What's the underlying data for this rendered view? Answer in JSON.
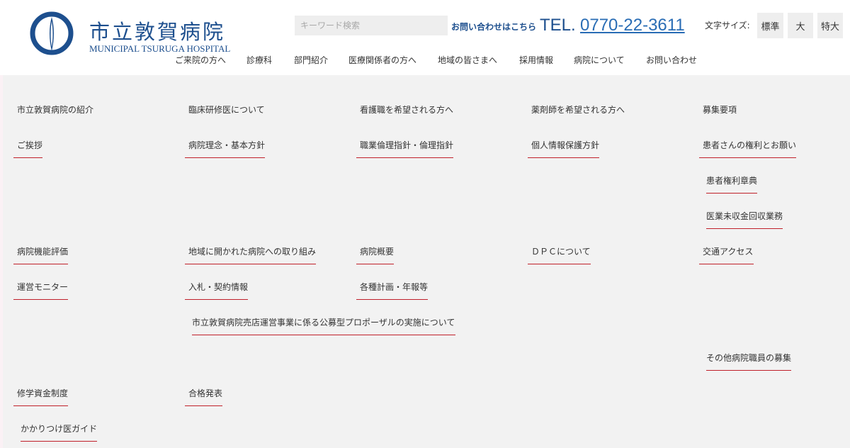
{
  "header": {
    "logo_ja": "市立敦賀病院",
    "logo_en": "MUNICIPAL TSURUGA HOSPITAL",
    "search_placeholder": "キーワード検索",
    "contact_label": "お問い合わせはこちら",
    "tel_prefix": "TEL.",
    "tel_number": "0770-22-3611",
    "font_size_label": "文字サイズ:",
    "font_sizes": [
      "標準",
      "大",
      "特大"
    ]
  },
  "global_nav": [
    "ご来院の方へ",
    "診療科",
    "部門紹介",
    "医療関係者の方へ",
    "地域の皆さまへ",
    "採用情報",
    "病院について",
    "お問い合わせ"
  ],
  "mega_menu": {
    "col_headings": [
      "市立敦賀病院の紹介",
      "臨床研修医について",
      "看護職を希望される方へ",
      "薬剤師を希望される方へ",
      "募集要項"
    ],
    "items": [
      "ご挨拶",
      "病院理念・基本方針",
      "職業倫理指針・倫理指針",
      "個人情報保護方針",
      "患者さんの権利とお願い",
      "患者権利章典",
      "医業未収金回収業務",
      "病院機能評価",
      "地域に開かれた病院への取り組み",
      "病院概要",
      "ＤＰＣについて",
      "交通アクセス",
      "運営モニター",
      "入札・契約情報",
      "各種計画・年報等",
      "市立敦賀病院売店運営事業に係る公募型プロポーザルの実施について",
      "その他病院職員の募集",
      "修学資金制度",
      "合格発表",
      "かかりつけ医ガイド"
    ]
  },
  "colors": {
    "brand_blue": "#1d4f8e",
    "link_blue": "#2a6db5",
    "accent_red": "#c0202a",
    "panel_bg": "#f2f2f2"
  }
}
